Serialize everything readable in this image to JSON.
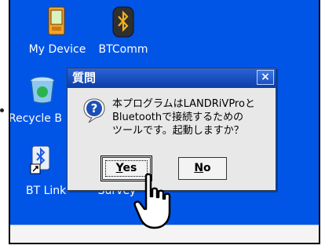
{
  "desktop": {
    "icons": [
      {
        "label": "My Device",
        "icon": "pda-device-icon"
      },
      {
        "label": "BTComm",
        "icon": "bluetooth-app-icon"
      },
      {
        "label": "Recycle B",
        "icon": "recycle-bin-icon"
      },
      {
        "label": "BT Link",
        "icon": "bluetooth-link-shortcut-icon"
      },
      {
        "label": "Survey",
        "icon": "survey-icon"
      }
    ]
  },
  "dialog": {
    "title": "質問",
    "close_label": "×",
    "message_lines": [
      "本プログラムはLANDRiVProと",
      "Bluetoothで接続するための",
      "ツールです。起動しますか？"
    ],
    "yes_mnemonic": "Y",
    "yes_rest": "es",
    "no_mnemonic": "N",
    "no_rest": "o",
    "icon": "question-icon"
  },
  "colors": {
    "desktop": "#0055e6",
    "titlebar": "#0a3ea8",
    "dialog_body": "#e8e8e8"
  }
}
